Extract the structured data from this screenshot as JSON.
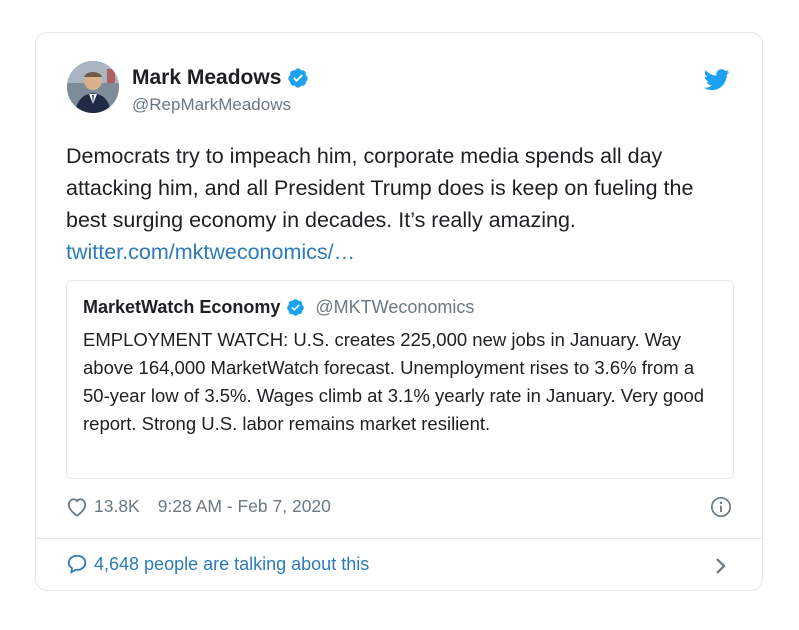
{
  "author": {
    "name": "Mark Meadows",
    "handle": "@RepMarkMeadows",
    "verified": true
  },
  "tweet": {
    "text": "Democrats try to impeach him, corporate media spends all day attacking him, and all President Trump does is keep on fueling the best surging economy in decades. It’s really amazing.",
    "link": "twitter.com/mktweconomics/…"
  },
  "quote": {
    "name": "MarketWatch Economy",
    "handle": "@MKTWeconomics",
    "verified": true,
    "text": "EMPLOYMENT WATCH: U.S. creates 225,000 new jobs in January. Way above 164,000 MarketWatch forecast. Unemployment rises to 3.6% from a 50-year low of 3.5%. Wages climb at 3.1% yearly rate in January. Very good report. Strong U.S. labor remains market resilient."
  },
  "meta": {
    "likes": "13.8K",
    "timestamp": "9:28 AM - Feb 7, 2020"
  },
  "footer": {
    "talking": "4,648 people are talking about this"
  },
  "icons": {
    "heart": "heart-icon",
    "info": "info-icon",
    "comment": "comment-icon",
    "chevron": "chevron-right-icon",
    "brand": "twitter-bird-icon"
  },
  "colors": {
    "link": "#2b7bb9",
    "verified": "#1da1f2",
    "muted": "#697882",
    "border": "#e1e8ed"
  }
}
